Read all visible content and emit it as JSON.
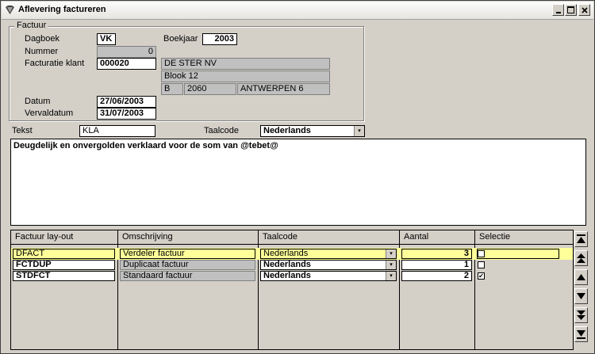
{
  "window": {
    "title": "Aflevering factureren"
  },
  "factuur": {
    "group_title": "Factuur",
    "dagboek_label": "Dagboek",
    "dagboek_value": "VK",
    "boekjaar_label": "Boekjaar",
    "boekjaar_value": "2003",
    "nummer_label": "Nummer",
    "nummer_value": "0",
    "facturatie_label": "Facturatie klant",
    "facturatie_value": "000020",
    "klant_naam": "DE STER NV",
    "klant_adres": "Blook 12",
    "klant_land": "B",
    "klant_postcode": "2060",
    "klant_gemeente": "ANTWERPEN 6",
    "datum_label": "Datum",
    "datum_value": "27/06/2003",
    "vervaldatum_label": "Vervaldatum",
    "vervaldatum_value": "31/07/2003"
  },
  "tekst": {
    "label": "Tekst",
    "value": "KLA",
    "taalcode_label": "Taalcode",
    "taalcode_value": "Nederlands",
    "body": "Deugdelijk en onvergolden verklaard voor de som van @tebet@"
  },
  "grid": {
    "columns": [
      "Factuur lay-out",
      "Omschrijving",
      "Taalcode",
      "Aantal",
      "Selectie"
    ],
    "rows": [
      {
        "layout": "DFACT",
        "omschrijving": "Verdeler factuur",
        "taalcode": "Nederlands",
        "aantal": "3",
        "selectie": ""
      },
      {
        "layout": "FCTDUP",
        "omschrijving": "Duplicaat factuur",
        "taalcode": "Nederlands",
        "aantal": "1",
        "selectie": ""
      },
      {
        "layout": "STDFCT",
        "omschrijving": "Standaard factuur",
        "taalcode": "Nederlands",
        "aantal": "2",
        "selectie": "✔"
      }
    ]
  },
  "colors": {
    "highlight": "#ffff99",
    "window": "#d4d0c8"
  }
}
